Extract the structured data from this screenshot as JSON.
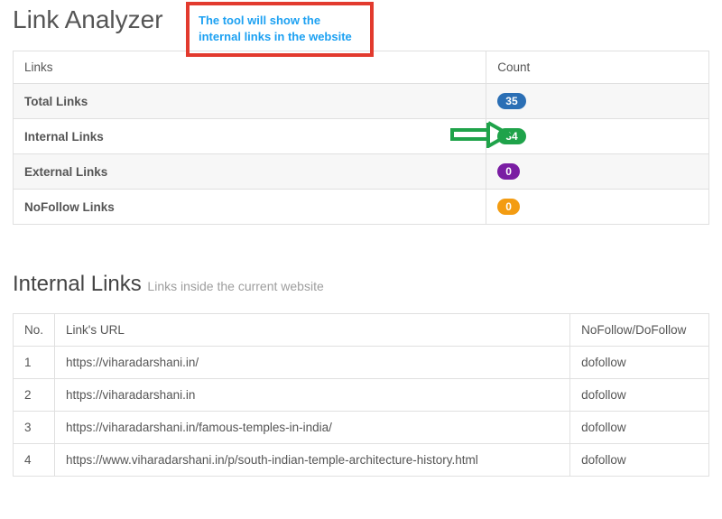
{
  "title": "Link Analyzer",
  "callout": "The tool will show the internal links in the website",
  "summary": {
    "col_links": "Links",
    "col_count": "Count",
    "rows": [
      {
        "label": "Total Links",
        "count": "35",
        "badge": "badge-blue"
      },
      {
        "label": "Internal Links",
        "count": "34",
        "badge": "badge-green"
      },
      {
        "label": "External Links",
        "count": "0",
        "badge": "badge-purple"
      },
      {
        "label": "NoFollow Links",
        "count": "0",
        "badge": "badge-orange"
      }
    ]
  },
  "internal_section": {
    "title": "Internal Links",
    "subtitle": "Links inside the current website",
    "col_no": "No.",
    "col_url": "Link's URL",
    "col_follow": "NoFollow/DoFollow",
    "rows": [
      {
        "no": "1",
        "url": "https://viharadarshani.in/",
        "follow": "dofollow"
      },
      {
        "no": "2",
        "url": "https://viharadarshani.in",
        "follow": "dofollow"
      },
      {
        "no": "3",
        "url": "https://viharadarshani.in/famous-temples-in-india/",
        "follow": "dofollow"
      },
      {
        "no": "4",
        "url": "https://www.viharadarshani.in/p/south-indian-temple-architecture-history.html",
        "follow": "dofollow"
      }
    ]
  }
}
